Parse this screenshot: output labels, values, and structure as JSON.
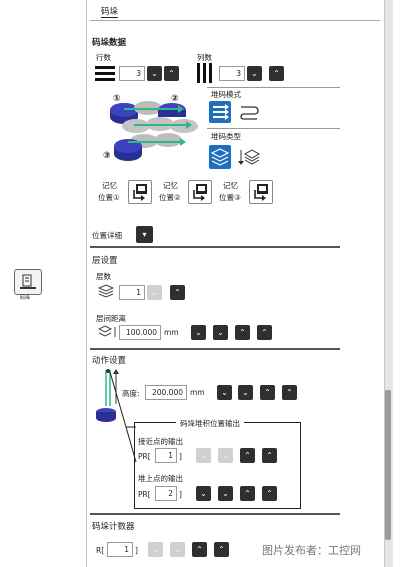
{
  "side": {
    "label": "码垛"
  },
  "tab": {
    "label": "码垛"
  },
  "data_section": {
    "title": "码垛数据",
    "rows_label": "行数",
    "rows_value": "3",
    "cols_label": "列数",
    "cols_value": "3",
    "mode_label": "堆码模式",
    "type_label": "堆码类型",
    "markers": [
      "①",
      "②",
      "③"
    ]
  },
  "memory": [
    {
      "line1": "记忆",
      "line2": "位置①"
    },
    {
      "line1": "记忆",
      "line2": "位置②"
    },
    {
      "line1": "记忆",
      "line2": "位置③"
    }
  ],
  "detail": {
    "label": "位置详细"
  },
  "layer": {
    "title": "层设置",
    "count_label": "层数",
    "count_value": "1",
    "dist_label": "层间距离",
    "dist_value": "100.000",
    "unit": "mm"
  },
  "action": {
    "title": "动作设置",
    "height_label": "高度:",
    "height_value": "200.000",
    "unit": "mm",
    "group_title": "码垛堆积位置输出",
    "approach_label": "接近点的输出",
    "approach_prefix": "PR[",
    "approach_value": "1",
    "bracket": "]",
    "stack_label": "堆上点的输出",
    "stack_prefix": "PR[",
    "stack_value": "2"
  },
  "counter": {
    "title": "码垛计数器",
    "prefix": "R[",
    "value": "1",
    "bracket": "]"
  },
  "watermark": "图片发布者：工控网",
  "colors": {
    "accent": "#1f6fbf",
    "cylinder": "#3338a8",
    "arrow": "#2fb88a",
    "dark_btn": "#2f2f2f"
  }
}
